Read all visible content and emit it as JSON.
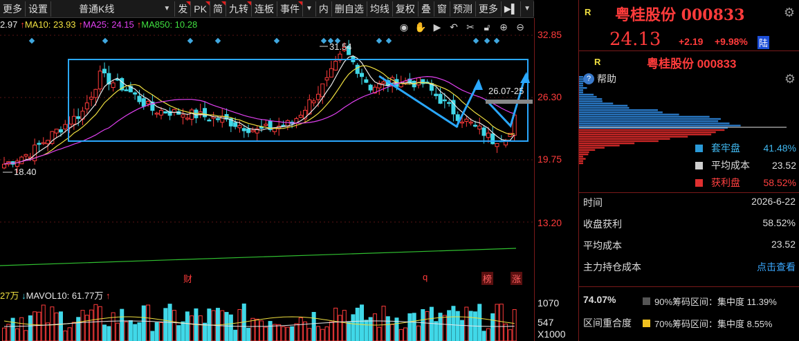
{
  "toolbar": {
    "more_left": "更多",
    "settings": "设置",
    "kline_select": "普通K线",
    "items": [
      "发",
      "PK",
      "简",
      "九转",
      "连板",
      "事件"
    ],
    "items2": [
      "内",
      "删自选",
      "均线",
      "复权",
      "叠",
      "窗",
      "预测",
      "更多"
    ]
  },
  "ma_legend": {
    "ma5_prefix": "2.97",
    "ma10": "MA10: 23.93",
    "ma25": "MA25: 24.15",
    "ma850": "MA850: 10.28"
  },
  "price_axis": {
    "labels": [
      "32.85",
      "26.30",
      "19.75",
      "13.20"
    ]
  },
  "annotations": {
    "high_label": "31.54",
    "low_label": "18.40",
    "range_label": "26.07-25",
    "markers": [
      "财",
      "q",
      "榜",
      "涨"
    ]
  },
  "volume": {
    "legend_prefix": "27万",
    "mavol10": "MAVOL10: 61.77万",
    "axis_labels": [
      "1070",
      "547"
    ],
    "unit": "X1000"
  },
  "quote": {
    "r_tag": "R",
    "name": "粤桂股份 000833",
    "price": "24.13",
    "change": "+2.19",
    "change_pct": "+9.98%",
    "badge": "陆"
  },
  "chip_panel": {
    "r_tag": "R",
    "name": "粤桂股份 000833",
    "help": "帮助",
    "legend": [
      {
        "name": "套牢盘",
        "value": "41.48%",
        "color": "#2a9ad8"
      },
      {
        "name": "平均成本",
        "value": "23.52",
        "color": "#cfcfcf"
      },
      {
        "name": "获利盘",
        "value": "58.52%",
        "color": "#e03030"
      }
    ]
  },
  "stats": {
    "rows": [
      {
        "label": "时间",
        "value": "2026-6-22"
      },
      {
        "label": "收盘获利",
        "value": "58.52%"
      },
      {
        "label": "平均成本",
        "value": "23.52"
      },
      {
        "label": "主力持仓成本",
        "value": "点击查看"
      }
    ]
  },
  "concentration": {
    "pct": "74.07%",
    "label": "区间重合度",
    "lines": [
      {
        "text": "90%筹码区间：集中度 11.39%",
        "color": "#555555"
      },
      {
        "text": "70%筹码区间：集中度  8.55%",
        "color": "#f0c020"
      }
    ]
  },
  "colors": {
    "up": "#ff3b3b",
    "down": "#40d8e8",
    "ma5": "#e8e8e8",
    "ma10": "#f0e040",
    "ma25": "#e040f0",
    "ma850": "#30c030",
    "box": "#2aa8ff"
  }
}
